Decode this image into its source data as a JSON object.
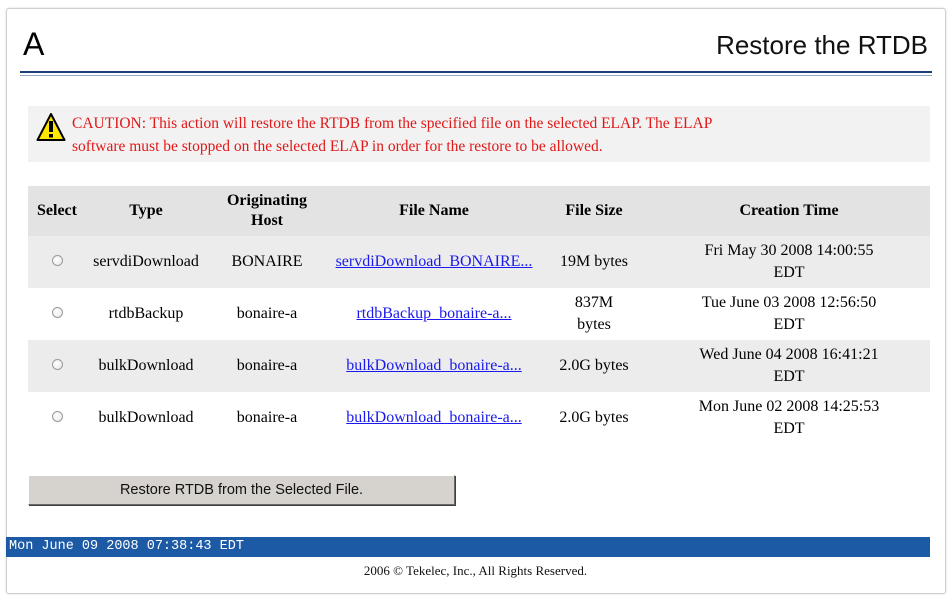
{
  "header": {
    "letter": "A",
    "title": "Restore the RTDB"
  },
  "caution": {
    "icon": "warning-icon",
    "lines": [
      "CAUTION: This action will restore the RTDB from the specified file on the selected ELAP. The ELAP",
      "software must be stopped on the selected ELAP in order for the restore to be allowed."
    ]
  },
  "table": {
    "headers": {
      "select": "Select",
      "type": "Type",
      "host_line1": "Originating",
      "host_line2": "Host",
      "file_name": "File Name",
      "file_size": "File Size",
      "creation_time": "Creation Time"
    },
    "rows": [
      {
        "type": "servdiDownload",
        "host": "BONAIRE",
        "file_name": "servdiDownload_BONAIRE...",
        "size_line1": "19M bytes",
        "size_line2": "",
        "time_line1": "Fri May 30 2008 14:00:55",
        "time_line2": "EDT"
      },
      {
        "type": "rtdbBackup",
        "host": "bonaire-a",
        "file_name": "rtdbBackup_bonaire-a...",
        "size_line1": "837M",
        "size_line2": "bytes",
        "time_line1": "Tue June 03 2008 12:56:50",
        "time_line2": "EDT"
      },
      {
        "type": "bulkDownload",
        "host": "bonaire-a",
        "file_name": "bulkDownload_bonaire-a...",
        "size_line1": "2.0G bytes",
        "size_line2": "",
        "time_line1": "Wed June 04 2008 16:41:21",
        "time_line2": "EDT"
      },
      {
        "type": "bulkDownload",
        "host": "bonaire-a",
        "file_name": "bulkDownload_bonaire-a...",
        "size_line1": "2.0G bytes",
        "size_line2": "",
        "time_line1": "Mon June 02 2008 14:25:53",
        "time_line2": "EDT"
      }
    ]
  },
  "restore_button": {
    "label": "Restore RTDB from the Selected File."
  },
  "status_bar": {
    "time": "Mon June 09 2008 07:38:43 EDT"
  },
  "footer": {
    "copyright": "2006 © Tekelec, Inc., All Rights Reserved."
  },
  "colors": {
    "caution_text": "#e11818",
    "link": "#1a1aee",
    "status_bar": "#1d5aa6",
    "header_rule": "#1f3f7a"
  }
}
